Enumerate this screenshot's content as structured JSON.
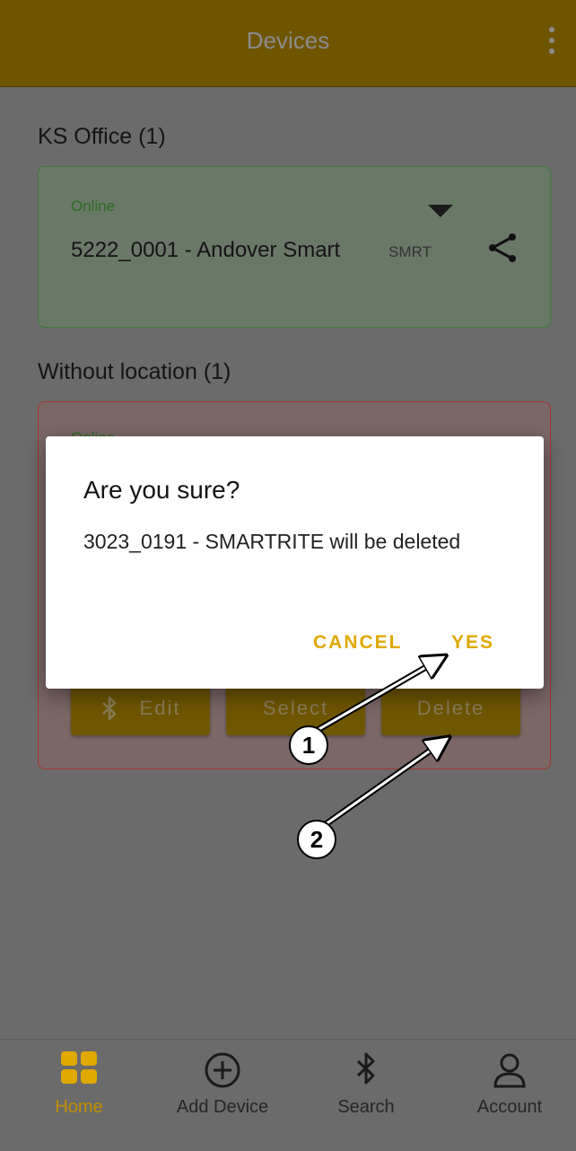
{
  "appbar": {
    "title": "Devices",
    "menu_icon": "more-vert-icon"
  },
  "sections": [
    {
      "title": "KS Office (1)"
    },
    {
      "title": "Without location (1)"
    }
  ],
  "card1": {
    "status": "Online",
    "device_name": "5222_0001 - Andover Smart",
    "type": "SMRT",
    "expand_icon": "dropdown-triangle-icon",
    "share_icon": "share-icon"
  },
  "card2": {
    "status": "Online",
    "buttons": {
      "edit": "Edit",
      "select": "Select",
      "delete": "Delete"
    }
  },
  "dialog": {
    "title": "Are you sure?",
    "message": "3023_0191 - SMARTRITE will be deleted",
    "cancel": "CANCEL",
    "yes": "YES"
  },
  "nav": {
    "home": "Home",
    "add": "Add Device",
    "search": "Search",
    "account": "Account"
  },
  "callouts": {
    "one": "1",
    "two": "2"
  },
  "colors": {
    "accent": "#E0A800",
    "online": "#2E7D32",
    "appbar": "#6F5500"
  }
}
